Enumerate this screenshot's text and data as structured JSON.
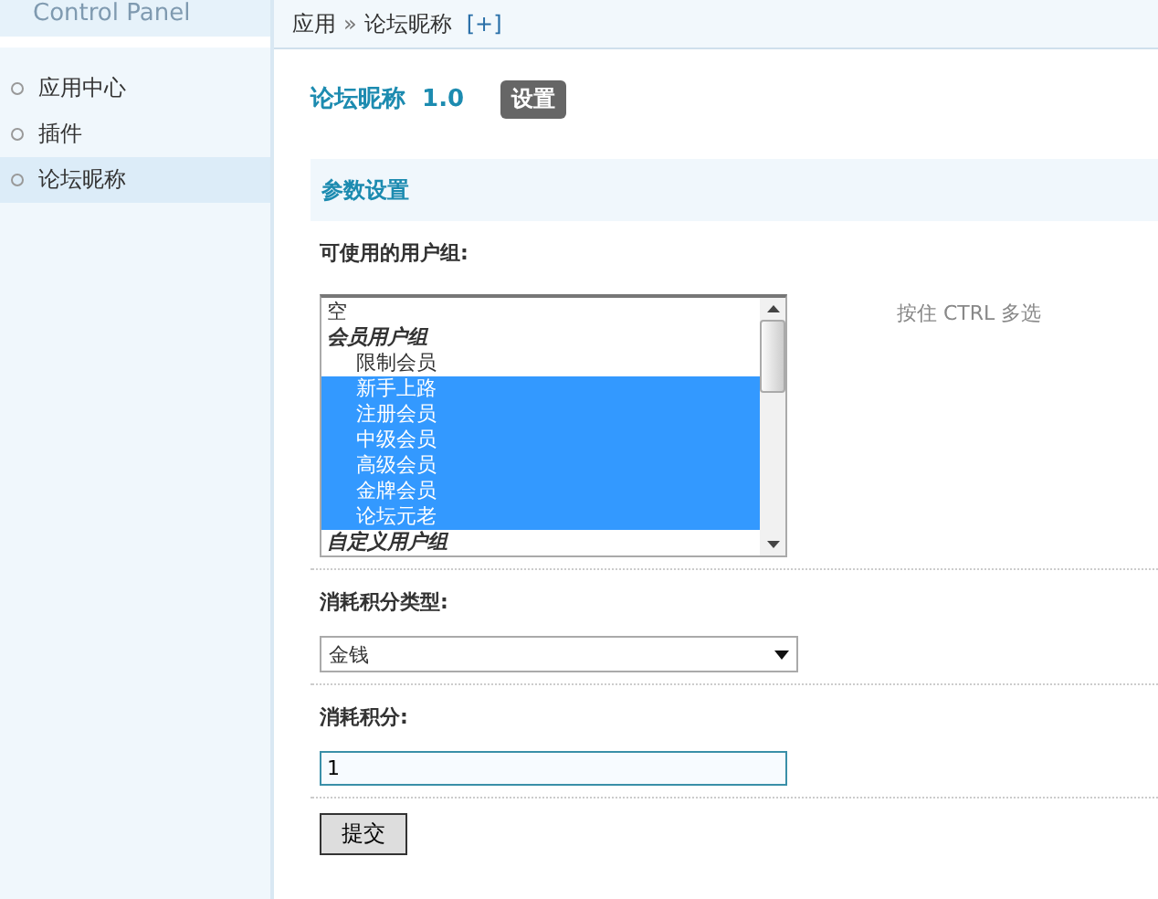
{
  "sidebar": {
    "logo": "Control Panel",
    "items": [
      {
        "label": "应用中心",
        "selected": false
      },
      {
        "label": "插件",
        "selected": false
      },
      {
        "label": "论坛昵称",
        "selected": true
      }
    ]
  },
  "breadcrumb": {
    "items": [
      "应用",
      "论坛昵称"
    ],
    "separator": "»",
    "add": "[+]"
  },
  "page": {
    "title": "论坛昵称",
    "version": "1.0",
    "badge": "设置"
  },
  "section": {
    "title": "参数设置"
  },
  "groups_field": {
    "label": "可使用的用户组:",
    "hint": "按住 CTRL 多选",
    "options": [
      {
        "kind": "option",
        "label": "空",
        "selected": false
      },
      {
        "kind": "group",
        "label": "会员用户组",
        "children": [
          {
            "label": "限制会员",
            "selected": false
          },
          {
            "label": "新手上路",
            "selected": true
          },
          {
            "label": "注册会员",
            "selected": true
          },
          {
            "label": "中级会员",
            "selected": true
          },
          {
            "label": "高级会员",
            "selected": true
          },
          {
            "label": "金牌会员",
            "selected": true
          },
          {
            "label": "论坛元老",
            "selected": true
          }
        ]
      },
      {
        "kind": "group",
        "label": "自定义用户组"
      }
    ]
  },
  "credit_type_field": {
    "label": "消耗积分类型:",
    "value": "金钱"
  },
  "credit_field": {
    "label": "消耗积分:",
    "value": "1"
  },
  "submit": "提交"
}
